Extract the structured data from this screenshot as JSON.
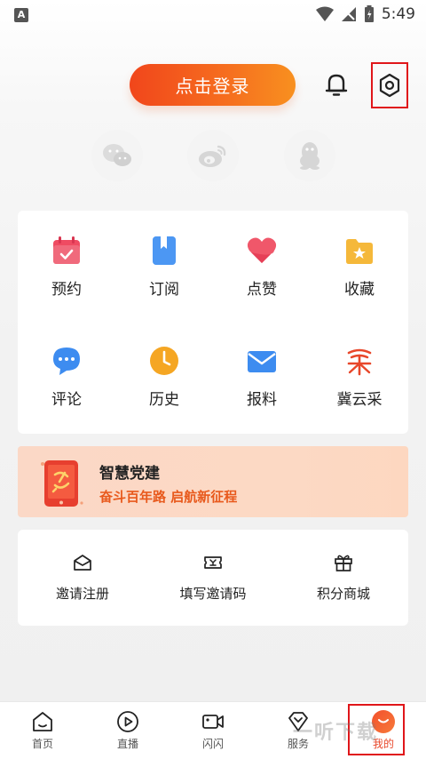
{
  "status_bar": {
    "time": "5:49",
    "left_icon": "A"
  },
  "header": {
    "login_label": "点击登录",
    "bell_icon": "bell-icon",
    "settings_icon": "settings-icon"
  },
  "social": [
    {
      "name": "wechat-icon"
    },
    {
      "name": "weibo-icon"
    },
    {
      "name": "qq-icon"
    }
  ],
  "grid": [
    {
      "label": "预约",
      "icon": "calendar-icon",
      "color": "#ee4a5f"
    },
    {
      "label": "订阅",
      "icon": "bookmark-book-icon",
      "color": "#3d8cf0"
    },
    {
      "label": "点赞",
      "icon": "heart-icon",
      "color": "#f0576a"
    },
    {
      "label": "收藏",
      "icon": "folder-star-icon",
      "color": "#f5b83a"
    },
    {
      "label": "评论",
      "icon": "comment-icon",
      "color": "#3d8cf0"
    },
    {
      "label": "历史",
      "icon": "clock-icon",
      "color": "#f5a623"
    },
    {
      "label": "报料",
      "icon": "mail-icon",
      "color": "#3d8cf0"
    },
    {
      "label": "冀云采",
      "icon": "jiyuncai-logo-icon",
      "color": "#e8472a"
    }
  ],
  "banner": {
    "title": "智慧党建",
    "subtitle": "奋斗百年路 启航新征程"
  },
  "actions": [
    {
      "label": "邀请注册",
      "icon": "envelope-icon"
    },
    {
      "label": "填写邀请码",
      "icon": "ticket-icon"
    },
    {
      "label": "积分商城",
      "icon": "gift-icon"
    }
  ],
  "bottom_nav": [
    {
      "label": "首页",
      "icon": "home-icon"
    },
    {
      "label": "直播",
      "icon": "play-icon"
    },
    {
      "label": "闪闪",
      "icon": "video-camera-icon"
    },
    {
      "label": "服务",
      "icon": "diamond-icon"
    },
    {
      "label": "我的",
      "icon": "me-icon",
      "active": true
    }
  ],
  "watermark": "一听下载"
}
